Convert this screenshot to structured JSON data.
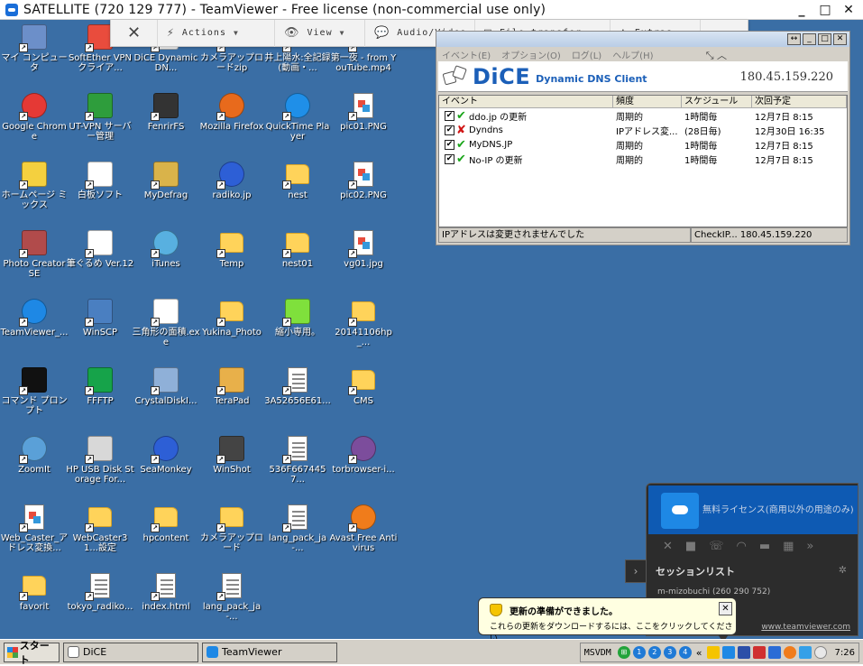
{
  "window": {
    "title": "SATELLITE (720 129 777) - TeamViewer - Free license (non-commercial use only)",
    "minimize": "_",
    "maximize": "□",
    "close": "✕"
  },
  "toolbar": {
    "close_glyph": "✕",
    "items": [
      {
        "label": "Actions",
        "icon": "⚡"
      },
      {
        "label": "View",
        "icon": "👁"
      },
      {
        "label": "Audio/Video",
        "icon": "💬"
      },
      {
        "label": "File transfer",
        "icon": "▤"
      },
      {
        "label": "Extras",
        "icon": "✱"
      }
    ]
  },
  "desktop_icons": [
    {
      "label": "マイ コンピュータ",
      "glyph": "pc",
      "color": "#6c8fc9"
    },
    {
      "label": "SoftEther VPN クライア...",
      "glyph": "vpn",
      "color": "#e94c3d"
    },
    {
      "label": "DiCE DynamicDN...",
      "glyph": "dice",
      "color": "#ffffff"
    },
    {
      "label": "カメラアップロードzip",
      "glyph": "folder"
    },
    {
      "label": "井上陽水:全記録(動画・...",
      "glyph": "folder"
    },
    {
      "label": "第一夜 - from YouTube.mp4",
      "glyph": "folder"
    },
    {
      "label": "Google Chrome",
      "glyph": "chrome",
      "color": "#e53935"
    },
    {
      "label": "UT-VPN サーバー管理",
      "glyph": "vpn2",
      "color": "#2e9d3c"
    },
    {
      "label": "FenrirFS",
      "glyph": "fenrir",
      "color": "#333333"
    },
    {
      "label": "Mozilla Firefox",
      "glyph": "firefox",
      "color": "#e86a1c"
    },
    {
      "label": "QuickTime Player",
      "glyph": "qt",
      "color": "#1f8fe8"
    },
    {
      "label": "pic01.PNG",
      "glyph": "png"
    },
    {
      "label": "ホームページ ミックス",
      "glyph": "hp",
      "color": "#f4d03f"
    },
    {
      "label": "白板ソフト",
      "glyph": "board",
      "color": "#ffffff"
    },
    {
      "label": "MyDefrag",
      "glyph": "defrag",
      "color": "#d9b34a"
    },
    {
      "label": "radiko.jp",
      "glyph": "radiko",
      "color": "#2d5fd6"
    },
    {
      "label": "nest",
      "glyph": "folder"
    },
    {
      "label": "pic02.PNG",
      "glyph": "png"
    },
    {
      "label": "Photo Creator SE",
      "glyph": "photo",
      "color": "#b14b4b"
    },
    {
      "label": "筆ぐるめ Ver.12",
      "glyph": "fude",
      "color": "#ffffff"
    },
    {
      "label": "iTunes",
      "glyph": "itunes",
      "color": "#58b0e0"
    },
    {
      "label": "Temp",
      "glyph": "folder"
    },
    {
      "label": "nest01",
      "glyph": "folder"
    },
    {
      "label": "vg01.jpg",
      "glyph": "jpg"
    },
    {
      "label": "TeamViewer_...",
      "glyph": "tv",
      "color": "#1e88e5"
    },
    {
      "label": "WinSCP",
      "glyph": "winscp",
      "color": "#4a7fc1"
    },
    {
      "label": "三角形の面積.exe",
      "glyph": "board",
      "color": "#ffffff"
    },
    {
      "label": "Yukina_Photo",
      "glyph": "folder"
    },
    {
      "label": "縮小専用。",
      "glyph": "shuku",
      "color": "#7fe03c"
    },
    {
      "label": "20141106hp_...",
      "glyph": "folder"
    },
    {
      "label": "コマンド プロンプト",
      "glyph": "cmd",
      "color": "#111111"
    },
    {
      "label": "FFFTP",
      "glyph": "ffftp",
      "color": "#16a34a"
    },
    {
      "label": "CrystalDiskI...",
      "glyph": "crystal",
      "color": "#8fb0d8"
    },
    {
      "label": "TeraPad",
      "glyph": "tera",
      "color": "#e8b04a"
    },
    {
      "label": "3A52656E61...",
      "glyph": "doc"
    },
    {
      "label": "CMS",
      "glyph": "folder"
    },
    {
      "label": "ZoomIt",
      "glyph": "zoom",
      "color": "#5aa0d8"
    },
    {
      "label": "HP USB Disk Storage For...",
      "glyph": "hpusb",
      "color": "#d8d8d8"
    },
    {
      "label": "SeaMonkey",
      "glyph": "sea",
      "color": "#2d5fd6"
    },
    {
      "label": "WinShot",
      "glyph": "winshot",
      "color": "#444444"
    },
    {
      "label": "536F6674457...",
      "glyph": "doc"
    },
    {
      "label": "torbrowser-i...",
      "glyph": "tor",
      "color": "#7c4d9c"
    },
    {
      "label": "Web_Caster_アドレス変換...",
      "glyph": "jpg"
    },
    {
      "label": "WebCaster31...設定",
      "glyph": "folder"
    },
    {
      "label": "hpcontent",
      "glyph": "folder"
    },
    {
      "label": "カメラアップロード",
      "glyph": "folder"
    },
    {
      "label": "lang_pack_ja-...",
      "glyph": "lang"
    },
    {
      "label": "Avast Free Antivirus",
      "glyph": "avast",
      "color": "#f07c1b"
    },
    {
      "label": "favorit",
      "glyph": "folder"
    },
    {
      "label": "tokyo_radiko...",
      "glyph": "doc"
    },
    {
      "label": "index.html",
      "glyph": "html"
    },
    {
      "label": "lang_pack_ja-...",
      "glyph": "lang"
    }
  ],
  "dice": {
    "menu": [
      "イベント(E)",
      "オプション(O)",
      "ログ(L)",
      "ヘルプ(H)"
    ],
    "menu_extra": "⤡  ︿",
    "title_buttons": [
      "↔",
      "_",
      "□",
      "✕"
    ],
    "logo": "DiCE",
    "subtitle": "Dynamic DNS Client",
    "ip": "180.45.159.220",
    "columns": [
      "イベント",
      "頻度",
      "スケジュール",
      "次回予定"
    ],
    "rows": [
      {
        "checked": true,
        "status": "ok",
        "event": "ddo.jp の更新",
        "freq": "周期的",
        "schedule": "1時間毎",
        "next": "12月7日 8:15"
      },
      {
        "checked": true,
        "status": "ng",
        "event": "Dyndns",
        "freq": "IPアドレス変...",
        "schedule": "(28日毎)",
        "next": "12月30日 16:35"
      },
      {
        "checked": true,
        "status": "ok",
        "event": "MyDNS.JP",
        "freq": "周期的",
        "schedule": "1時間毎",
        "next": "12月7日 8:15"
      },
      {
        "checked": true,
        "status": "ok",
        "event": "No-IP の更新",
        "freq": "周期的",
        "schedule": "1時間毎",
        "next": "12月7日 8:15"
      }
    ],
    "status_left": "IPアドレスは変更されませんでした",
    "status_right": "CheckIP... 180.45.159.220"
  },
  "tvpanel": {
    "license": "無料ライセンス(商用以外の用途のみ)",
    "session_list": "セッションリスト",
    "person": "m-mizobuchi (260 290 752)",
    "site": "www.teamviewer.com",
    "arrow": "›"
  },
  "balloon": {
    "title": "更新の準備ができました。",
    "body": "これらの更新をダウンロードするには、ここをクリックしてください。",
    "close": "✕"
  },
  "taskbar": {
    "start": "スタート",
    "tasks": [
      {
        "label": "DiCE",
        "color": "#ffffff"
      },
      {
        "label": "TeamViewer",
        "color": "#1e88e5"
      }
    ],
    "tray_label": "MSVDM",
    "clock": "7:26"
  },
  "colors": {
    "desktop": "#3a6ea5",
    "dice_blue": "#1b5fb8",
    "ok": "#1aa51a",
    "ng": "#d01515"
  }
}
